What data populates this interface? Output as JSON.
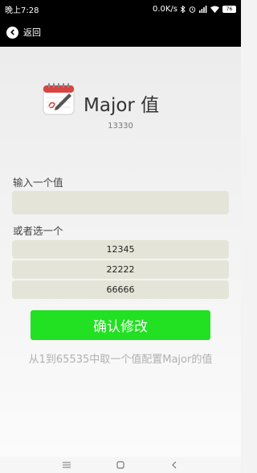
{
  "status_bar": {
    "time": "晚上7:28",
    "speed": "0.0K/s",
    "battery": "76"
  },
  "header": {
    "back_label": "返回"
  },
  "app": {
    "title": "Major 值",
    "current_value": "13330"
  },
  "form": {
    "input_label": "输入一个值",
    "input_value": "",
    "choose_label": "或者选一个",
    "options": [
      "12345",
      "22222",
      "66666"
    ],
    "confirm_label": "确认修改",
    "hint": "从1到65535中取一个值配置Major的值"
  },
  "colors": {
    "accent": "#22e022",
    "field_bg": "#e4e5d8"
  }
}
